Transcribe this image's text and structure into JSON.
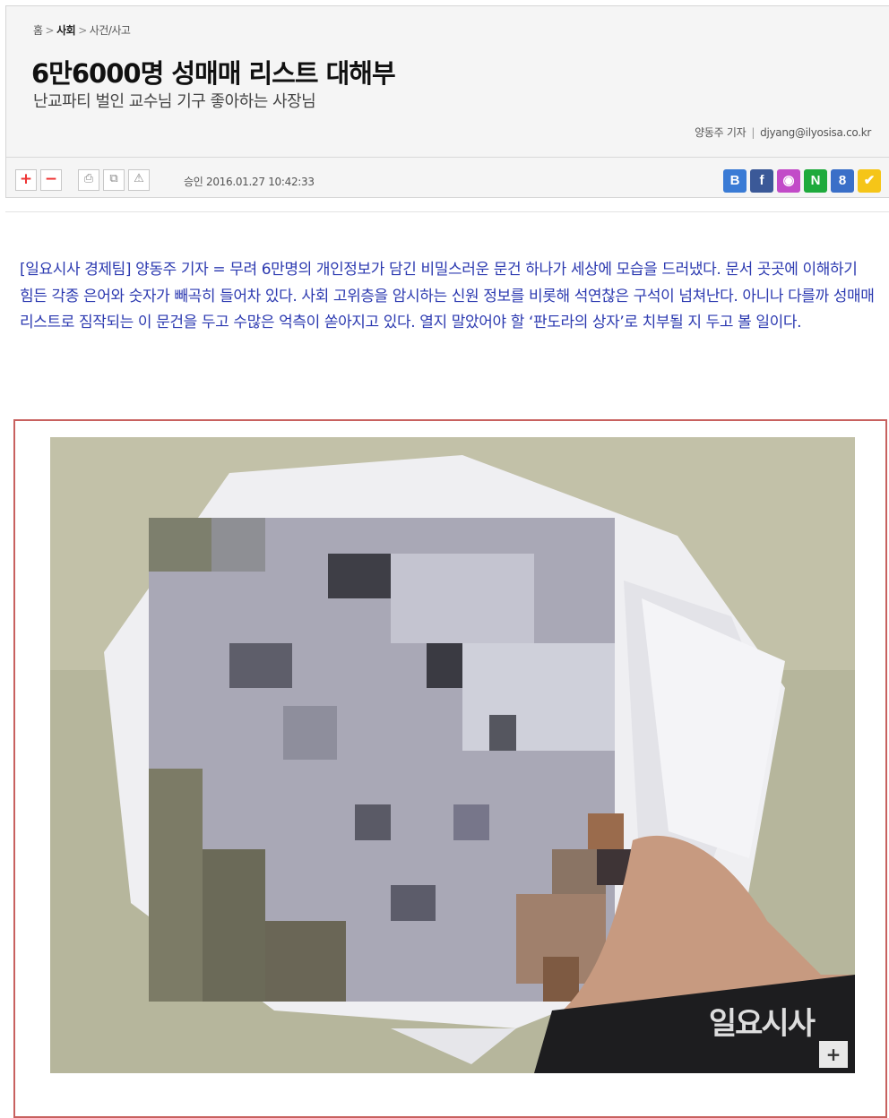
{
  "breadcrumb": {
    "home": "홈",
    "section": "사회",
    "subsection": "사건/사고",
    "sep": ">"
  },
  "article": {
    "title": "6만6000명 성매매 리스트 대해부",
    "subtitle": "난교파티 벌인 교수님 기구 좋아하는 사장님",
    "reporter": "양동주 기자",
    "email": "djyang@ilyosisa.co.kr",
    "approved": "승인 2016.01.27  10:42:33",
    "lead": "[일요시사 경제팀] 양동주 기자 = 무려 6만명의 개인정보가 담긴 비밀스러운 문건 하나가 세상에 모습을 드러냈다. 문서 곳곳에 이해하기 힘든 각종 은어와 숫자가 빼곡히 들어차 있다. 사회 고위층을 암시하는 신원 정보를 비롯해 석연찮은 구석이 넘쳐난다. 아니나 다를까 성매매 리스트로 짐작되는 이 문건을 두고 수많은 억측이 쏟아지고 있다. 열지 말았어야 할 ‘판도라의 상자’로 치부될 지 두고 볼 일이다."
  },
  "toolbar": {
    "zoom_in": "+",
    "zoom_out": "−",
    "print": "⎙",
    "copy": "⧉",
    "report": "⚠"
  },
  "social": [
    {
      "name": "blog",
      "label": "B",
      "color": "#3a7bd5"
    },
    {
      "name": "facebook",
      "label": "f",
      "color": "#3b5998"
    },
    {
      "name": "band",
      "label": "◉",
      "color": "#c24bc8"
    },
    {
      "name": "naver",
      "label": "N",
      "color": "#1eaa3c"
    },
    {
      "name": "google",
      "label": "8",
      "color": "#3a6fc8"
    },
    {
      "name": "twitter",
      "label": "✔",
      "color": "#f5c518"
    }
  ],
  "photo": {
    "watermark": "일요시사",
    "enlarge": "+"
  }
}
